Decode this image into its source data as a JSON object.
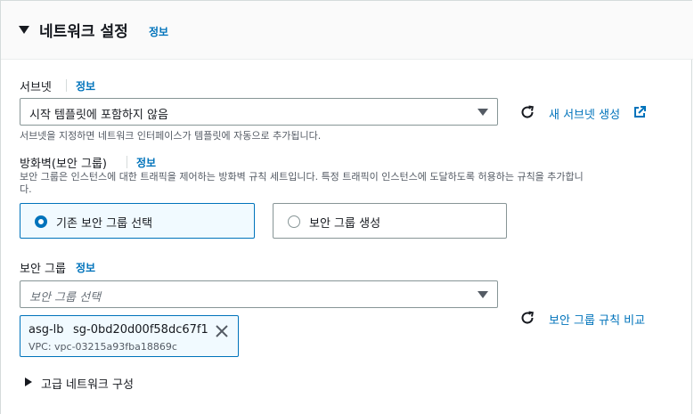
{
  "section": {
    "title": "네트워크 설정",
    "info": "정보"
  },
  "subnet": {
    "label": "서브넷",
    "info": "정보",
    "selected": "시작 템플릿에 포함하지 않음",
    "description": "서브넷을 지정하면 네트워크 인터페이스가 템플릿에 자동으로 추가됩니다.",
    "create_link": "새 서브넷 생성"
  },
  "firewall": {
    "label": "방화벽(보안 그룹)",
    "info": "정보",
    "description_line1": "보안 그룹은 인스턴스에 대한 트래픽을 제어하는 방화벽 규칙 세트입니다. 특정 트래픽이 인스턴스에 도달하도록 허용하는 규칙을 추가합니",
    "description_line2": "다.",
    "option_existing": "기존 보안 그룹 선택",
    "option_create": "보안 그룹 생성",
    "selected_option": "existing"
  },
  "security_group": {
    "label": "보안 그룹",
    "info": "정보",
    "placeholder": "보안 그룹 선택",
    "compare_link": "보안 그룹 규칙 비교",
    "token": {
      "name": "asg-lb",
      "id": "sg-0bd20d00f58dc67f1",
      "vpc": "VPC: vpc-03215a93fba18869c"
    }
  },
  "advanced": {
    "label": "고급 네트워크 구성"
  },
  "colors": {
    "link": "#0073bb",
    "border": "#879596",
    "selected_bg": "#f1faff"
  }
}
